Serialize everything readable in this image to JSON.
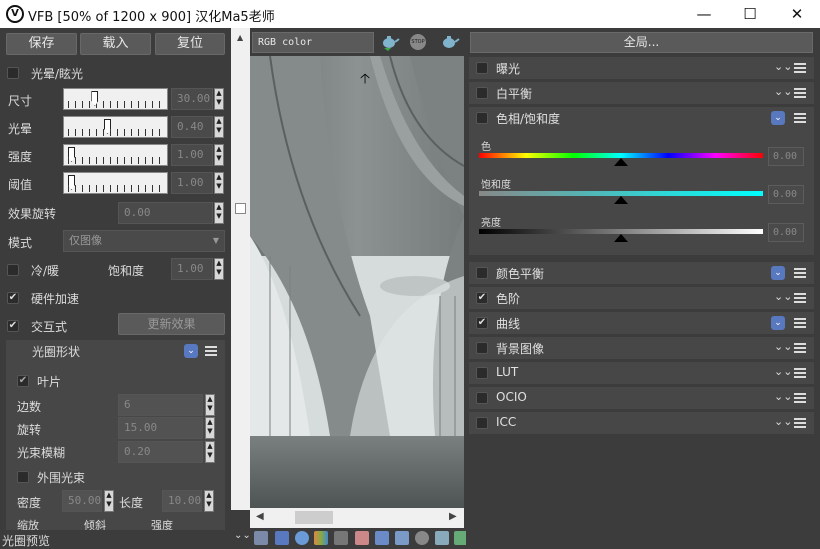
{
  "window": {
    "title": "VFB [50% of 1200 x 900] 汉化Ma5老师",
    "logo": "V",
    "minimize": "—",
    "maximize": "☐",
    "close": "✕"
  },
  "left": {
    "buttons": {
      "save": "保存",
      "load": "载入",
      "reset": "复位"
    },
    "bloom": {
      "label": "光晕/眩光",
      "checked": false
    },
    "sliders": [
      {
        "label": "尺寸",
        "value": "30.00",
        "level": 0.26
      },
      {
        "label": "光晕",
        "value": "0.40",
        "level": 0.4
      },
      {
        "label": "强度",
        "value": "1.00",
        "level": 0.0
      },
      {
        "label": "阈值",
        "value": "1.00",
        "level": 0.0
      }
    ],
    "effect_rotation": {
      "label": "效果旋转",
      "value": "0.00"
    },
    "mode": {
      "label": "模式",
      "value": "仅图像"
    },
    "cold_warm": {
      "label": "冷/暖",
      "checked": false
    },
    "saturation": {
      "label": "饱和度",
      "value": "1.00"
    },
    "hw_accel": {
      "label": "硬件加速",
      "checked": true
    },
    "interactive": {
      "label": "交互式",
      "checked": true
    },
    "update_effect": "更新效果",
    "aperture": {
      "title": "光圈形状",
      "blades": {
        "label": "叶片",
        "checked": true
      },
      "sides": {
        "label": "边数",
        "value": "6"
      },
      "rotation": {
        "label": "旋转",
        "value": "15.00"
      },
      "blur": {
        "label": "光束模糊",
        "value": "0.20"
      },
      "outer_beam": {
        "label": "外围光束",
        "checked": false
      },
      "density": {
        "label": "密度",
        "value": "50.00"
      },
      "length": {
        "label": "长度",
        "value": "10.00"
      },
      "cut_labels": [
        "缩放",
        "倾斜",
        "强度"
      ]
    },
    "footer": "光圈预览"
  },
  "center": {
    "channel": "RGB color",
    "stop_label": "STOP"
  },
  "right": {
    "global": "全局...",
    "rows": [
      {
        "label": "曝光",
        "checked": false
      },
      {
        "label": "白平衡",
        "checked": false
      },
      {
        "label": "色相/饱和度",
        "checked": false
      },
      {
        "label": "颜色平衡",
        "checked": false
      },
      {
        "label": "色阶",
        "checked": true
      },
      {
        "label": "曲线",
        "checked": true
      },
      {
        "label": "背景图像",
        "checked": false
      },
      {
        "label": "LUT",
        "checked": false
      },
      {
        "label": "OCIO",
        "checked": false
      },
      {
        "label": "ICC",
        "checked": false
      }
    ],
    "hue_sat": {
      "hue": {
        "label": "色",
        "value": "0.00",
        "level": 0.5
      },
      "saturation": {
        "label": "饱和度",
        "value": "0.00",
        "level": 0.5
      },
      "lightness": {
        "label": "亮度",
        "value": "0.00",
        "level": 0.5
      }
    }
  },
  "colors": {
    "accent": "#5878c0",
    "panel": "#3c3c3c",
    "row": "#474747"
  }
}
